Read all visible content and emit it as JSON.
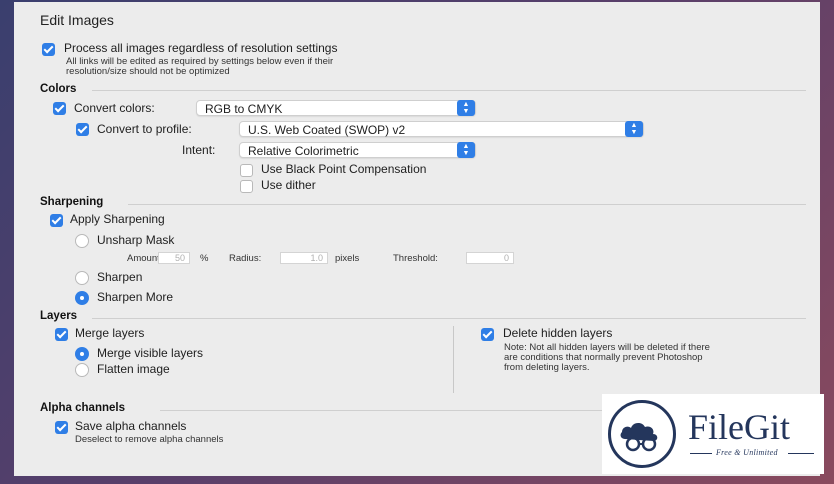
{
  "header": {
    "title": "Edit Images"
  },
  "process_all": {
    "label": "Process all images regardless of resolution settings",
    "checked": true,
    "note_line1": "All links will be edited as required by settings below even if their",
    "note_line2": "resolution/size should not be optimized"
  },
  "colors": {
    "section": "Colors",
    "convert_colors_label": "Convert colors:",
    "convert_colors_value": "RGB to CMYK",
    "convert_profile_label": "Convert to profile:",
    "convert_profile_value": "U.S. Web Coated (SWOP) v2",
    "intent_label": "Intent:",
    "intent_value": "Relative Colorimetric",
    "black_point_label": "Use Black Point Compensation",
    "dither_label": "Use dither"
  },
  "sharpening": {
    "section": "Sharpening",
    "apply_label": "Apply Sharpening",
    "unsharp_label": "Unsharp Mask",
    "amount_label": "Amount:",
    "amount_value": "50",
    "percent_label": "%",
    "radius_label": "Radius:",
    "radius_value": "1.0",
    "pixels_label": "pixels",
    "threshold_label": "Threshold:",
    "threshold_value": "0",
    "sharpen_label": "Sharpen",
    "sharpen_more_label": "Sharpen More"
  },
  "layers": {
    "section": "Layers",
    "merge_label": "Merge layers",
    "merge_visible_label": "Merge visible layers",
    "flatten_label": "Flatten image",
    "delete_hidden_label": "Delete hidden layers",
    "note_line1": "Note: Not all hidden layers will be deleted if there",
    "note_line2": "are conditions that normally prevent Photoshop",
    "note_line3": "from deleting layers."
  },
  "alpha": {
    "section": "Alpha channels",
    "save_label": "Save alpha channels",
    "note": "Deselect to remove alpha channels"
  },
  "watermark": {
    "name": "FileGit",
    "tagline": "Free & Unlimited"
  },
  "colors_theme": {
    "accent": "#2f7ee6",
    "brand": "#24365c"
  }
}
